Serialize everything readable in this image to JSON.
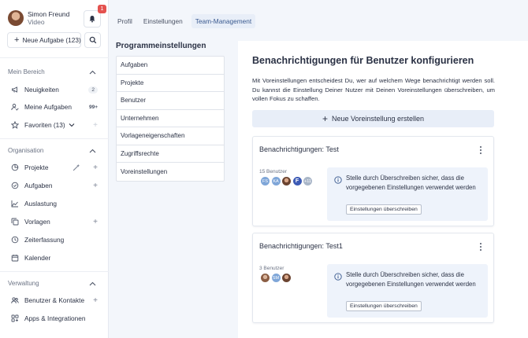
{
  "user": {
    "name": "Simon Freund",
    "role": "Video"
  },
  "notifications": {
    "count": "1"
  },
  "new_task_label": "Neue Aufgabe (123)",
  "sections": {
    "mein_bereich": {
      "label": "Mein Bereich",
      "items": [
        {
          "label": "Neuigkeiten",
          "count": "2"
        },
        {
          "label": "Meine Aufgaben",
          "count": "99+"
        },
        {
          "label": "Favoriten (13)"
        }
      ]
    },
    "organisation": {
      "label": "Organisation",
      "items": [
        {
          "label": "Projekte"
        },
        {
          "label": "Aufgaben"
        },
        {
          "label": "Auslastung"
        },
        {
          "label": "Vorlagen"
        },
        {
          "label": "Zeiterfassung"
        },
        {
          "label": "Kalender"
        }
      ]
    },
    "verwaltung": {
      "label": "Verwaltung",
      "items": [
        {
          "label": "Benutzer & Kontakte"
        },
        {
          "label": "Apps & Integrationen"
        }
      ]
    }
  },
  "tabs": [
    {
      "label": "Profil"
    },
    {
      "label": "Einstellungen"
    },
    {
      "label": "Team-Management"
    }
  ],
  "program_settings": {
    "title": "Programmeinstellungen",
    "items": [
      "Aufgaben",
      "Projekte",
      "Benutzer",
      "Unternehmen",
      "Vorlageneigenschaften",
      "Zugriffsrechte",
      "Voreinstellungen"
    ]
  },
  "main": {
    "title": "Benachrichtigungen für Benutzer konfigurieren",
    "description": "Mit Voreinstellungen entscheidest Du, wer auf welchem Wege benachrichtigt werden soll. Du kannst die Einstellung Deiner Nutzer mit Deinen Voreinstellungen überschreiben, um vollen Fokus zu schaffen.",
    "new_preset_label": "Neue Voreinstellung erstellen"
  },
  "cards": [
    {
      "title": "Benachrichtigungen: Test",
      "users_label": "15 Benutzer",
      "avatars": [
        {
          "initials": "FS",
          "color": "#7fa6d8"
        },
        {
          "initials": "KA",
          "color": "#7fa6d8"
        },
        {
          "initials": "",
          "color": ""
        },
        {
          "initials": "F",
          "color": "#3d5bb5"
        },
        {
          "initials": "+11",
          "color": "#a9b6c8"
        }
      ],
      "info": "Stelle durch Überschreiben sicher, dass die vorgegebenen Einstellungen verwendet werden",
      "button": "Einstellungen überschreiben"
    },
    {
      "title": "Benachrichtigungen: Test1",
      "users_label": "3 Benutzer",
      "avatars": [
        {
          "initials": "",
          "color": ""
        },
        {
          "initials": "SM",
          "color": "#7fa6d8"
        },
        {
          "initials": "",
          "color": ""
        }
      ],
      "info": "Stelle durch Überschreiben sicher, dass die vorgegebenen Einstellungen verwendet werden",
      "button": "Einstellungen überschreiben"
    }
  ]
}
